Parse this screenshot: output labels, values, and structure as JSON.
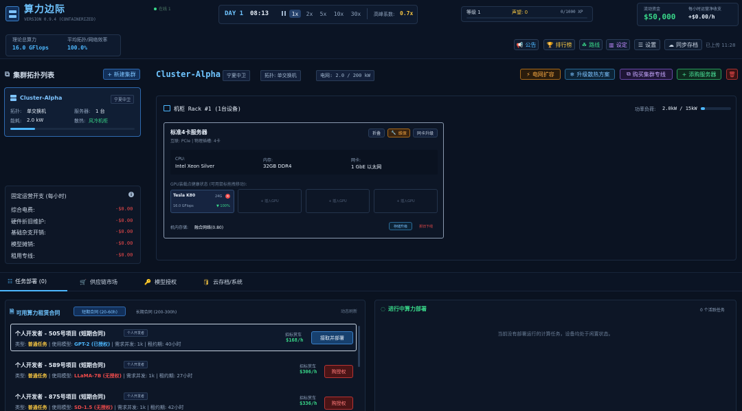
{
  "app": {
    "title": "算力边际",
    "version": "VERSION 0.9.4 (CONTAINERIZED)",
    "status": "在线 1"
  },
  "time": {
    "day": "DAY 1",
    "clock": "08:13",
    "speeds": [
      "1x",
      "2x",
      "5x",
      "10x",
      "30x"
    ],
    "active_speed": "1x",
    "demand_label": "高峰系数:",
    "demand_value": "0.7x"
  },
  "level": {
    "label": "等级 1",
    "fame_label": "声望: 0",
    "xp": "0/1000 XP",
    "xp_progress": 0
  },
  "funds": {
    "label": "流动资金",
    "value": "$50,000",
    "net_label": "每小时运营净收支",
    "net_value": "+$0.00/h"
  },
  "metrics": {
    "power_label": "理论总算力",
    "power_value": "16.0 GFlops",
    "eff_label": "平均拓扑/网络效率",
    "eff_value": "100.0%"
  },
  "toolbar": {
    "notice": "公告",
    "ranking": "排行榜",
    "route": "路线",
    "setting": "设定",
    "settings": "设置",
    "save": "同步存档",
    "uploaded": "已上传 11:28"
  },
  "sidebar": {
    "title": "集群拓扑列表",
    "new_button": "+ 新建集群",
    "cluster": {
      "name": "Cluster-Alpha",
      "region": "宁夏中卫",
      "topo_label": "拓扑:",
      "topo": "单交换机",
      "servers_label": "服务器:",
      "servers": "1 台",
      "power_label": "能耗:",
      "power": "2.0 kW",
      "cooling_label": "散热:",
      "cooling": "风冷机柜",
      "load": 0.2
    },
    "costs": {
      "title": "固定运营开支 (每小时)",
      "rows": [
        {
          "label": "综合电费:",
          "value": "-$0.00"
        },
        {
          "label": "硬件折旧维护:",
          "value": "-$0.00"
        },
        {
          "label": "基础杂支开销:",
          "value": "-$0.00"
        },
        {
          "label": "模型摊销:",
          "value": "-$0.00"
        },
        {
          "label": "租用专线:",
          "value": "-$0.00"
        }
      ]
    }
  },
  "cluster_header": {
    "name": "Cluster-Alpha",
    "region": "宁夏中卫",
    "topo": "拓扑: 单交换机",
    "network": "电网: 2.0 / 200 kW",
    "actions": {
      "grid": "电网扩容",
      "cooling": "升级散热方案",
      "line": "购买集群专线",
      "add": "添购服务器"
    }
  },
  "rack": {
    "title": "机柜 Rack #1 (1台设备)",
    "load_label": "功率负荷:",
    "load_value": "2.0kW / 15kW",
    "load_ratio": 0.13
  },
  "server": {
    "name": "标准4卡服务器",
    "sub": "互联: PCIe | 物理插槽: 4卡",
    "btn_fold": "折叠",
    "btn_repair": "维保",
    "btn_upgrade": "同卡升级",
    "cpu_label": "CPU:",
    "cpu": "Intel Xeon Silver",
    "mem_label": "内存:",
    "mem": "32GB DDR4",
    "nic_label": "网卡:",
    "nic": "1 GbE 以太网",
    "gpu_caption": "GPU装载点健康状态 (可用鼠标拖拽移动):",
    "gpu": {
      "name": "Tesla K80",
      "mem": "24G",
      "flops": "16.0 GFlops",
      "health": "▼ 100%"
    },
    "empty_slot": "+ 插入GPU",
    "storage_label": "机内存储:",
    "storage": "融合网络(0.80)",
    "btn_storage": "存储升级",
    "btn_remove": "折旧下线"
  },
  "tabs": [
    "任务部署 (0)",
    "供应链市场",
    "模型授权",
    "云存档/系统"
  ],
  "contracts": {
    "title": "可用算力租赁合同",
    "tab_short": "短期合同 (20-60h)",
    "tab_long": "长期合同 (200-300h)",
    "refresh": "动态刷新",
    "reward_label": "招标赏车",
    "items": [
      {
        "title": "个人开发者 - 505号项目 (短期合同)",
        "tag": "个人开发者",
        "type_label": "类型:",
        "type": "普通任务",
        "model_label": "| 使用模型:",
        "model": "GPT-2 (已授权)",
        "concurrency": "| 需求并发: 1k",
        "period": "| 租约期: 40小时",
        "reward": "$168/h",
        "action": "接取并部署"
      },
      {
        "title": "个人开发者 - 589号项目 (短期合同)",
        "tag": "个人开发者",
        "type_label": "类型:",
        "type": "普通任务",
        "model_label": "| 使用模型:",
        "model": "LLaMA-7B (无授权)",
        "concurrency": "| 需求并发: 1k",
        "period": "| 租约期: 27小时",
        "reward": "$306/h",
        "action": "购授权"
      },
      {
        "title": "个人开发者 - 875号项目 (短期合同)",
        "tag": "个人开发者",
        "type_label": "类型:",
        "type": "普通任务",
        "model_label": "| 使用模型:",
        "model": "SD-1.5 (无授权)",
        "concurrency": "| 需求并发: 1k",
        "period": "| 租约期: 42小时",
        "reward": "$336/h",
        "action": "购授权"
      }
    ]
  },
  "running": {
    "title": "进行中算力部署",
    "count": "0 个活跃任务",
    "empty": "当前没有部署运行的计算任务，设备均处于闲置状态。"
  },
  "colors": {
    "accent": "#4db8ff",
    "green": "#39d98a",
    "red": "#ef4b4b",
    "yellow": "#f5c542",
    "bg": "#0a1220"
  }
}
